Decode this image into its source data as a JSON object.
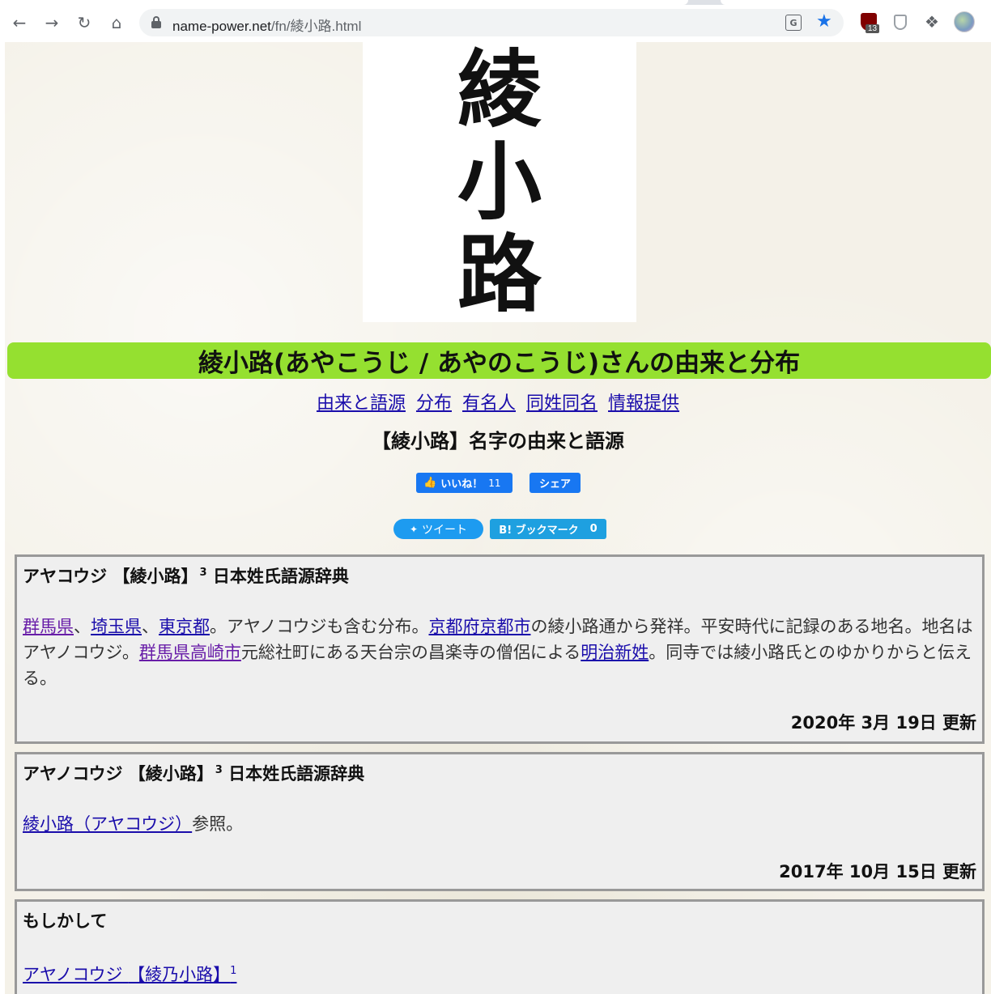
{
  "browser": {
    "url_host": "name-power.net",
    "url_path": "/fn/綾小路.html",
    "extension_badge": "13"
  },
  "hero": {
    "chars": [
      "綾",
      "小",
      "路"
    ]
  },
  "title": "綾小路(あやこうじ / あやのこうじ)さんの由来と分布",
  "subnav": [
    "由来と語源",
    "分布",
    "有名人",
    "同姓同名",
    "情報提供"
  ],
  "section_heading": "【綾小路】名字の由来と語源",
  "social": {
    "like_label": "いいね！",
    "like_count": "11",
    "share_label": "シェア",
    "tweet_label": "ツイート",
    "hatena_label": "B! ブックマーク",
    "hatena_count": "0"
  },
  "entries": [
    {
      "reading": "アヤコウジ",
      "kanji": "【綾小路】",
      "sup": "3",
      "source": "日本姓氏語源辞典",
      "body": {
        "link1": "群馬県",
        "sep1": "、",
        "link2": "埼玉県",
        "sep2": "、",
        "link3": "東京都",
        "text1": "。アヤノコウジも含む分布。",
        "link4": "京都府京都市",
        "text2": "の綾小路通から発祥。平安時代に記録のある地名。地名はアヤノコウジ。",
        "link5": "群馬県高崎市",
        "text3": "元総社町にある天台宗の昌楽寺の僧侶による",
        "link6": "明治新姓",
        "text4": "。同寺では綾小路氏とのゆかりからと伝える。"
      },
      "date": "2020年 3月 19日 更新"
    },
    {
      "reading": "アヤノコウジ",
      "kanji": "【綾小路】",
      "sup": "3",
      "source": "日本姓氏語源辞典",
      "body": {
        "link1": "綾小路（アヤコウジ）",
        "text1": "参照。"
      },
      "date": "2017年 10月 15日 更新"
    }
  ],
  "maybe": {
    "heading": "もしかして",
    "reading": "アヤノコウジ",
    "kanji": "【綾乃小路】",
    "sup": "1"
  }
}
